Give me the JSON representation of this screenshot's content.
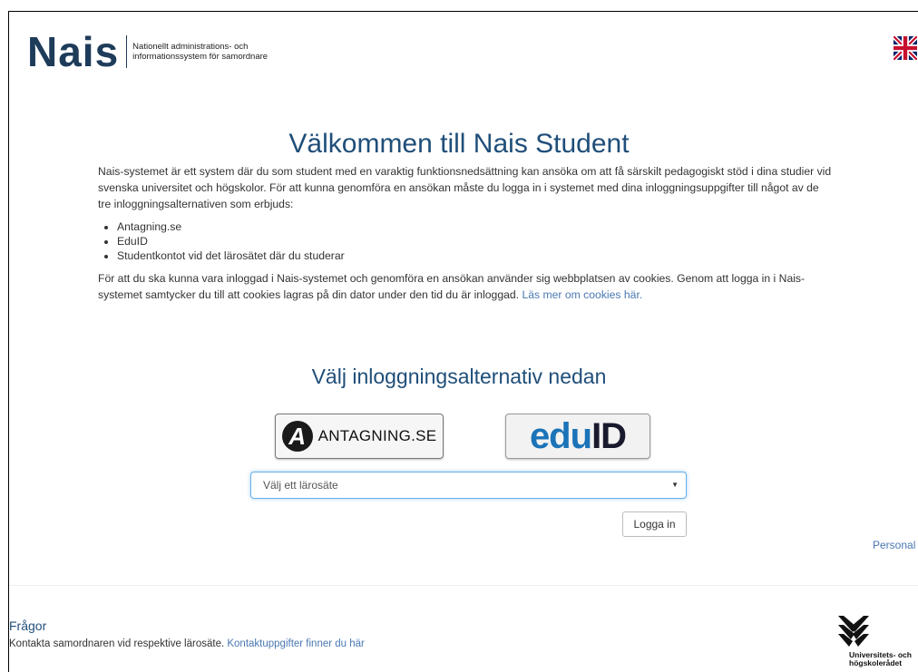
{
  "header": {
    "logo_text": "Nais",
    "logo_subtitle_line1": "Nationellt administrations- och",
    "logo_subtitle_line2": "informationssystem för samordnare",
    "language_flag_icon": "uk-flag-icon"
  },
  "welcome": {
    "title": "Välkommen till Nais Student",
    "intro": "Nais-systemet är ett system där du som student med en varaktig funktionsnedsättning kan ansöka om att få särskilt pedagogiskt stöd i dina studier vid svenska universitet och högskolor. För att kunna genomföra en ansökan måste du logga in i systemet med dina inloggningsuppgifter till något av de tre inloggningsalternativen som erbjuds:",
    "options": [
      "Antagning.se",
      "EduID",
      "Studentkontot vid det lärosätet där du studerar"
    ],
    "cookies_text": "För att du ska kunna vara inloggad i Nais-systemet och genomföra en ansökan använder sig webbplatsen av cookies. Genom att logga in i Nais-systemet samtycker du till att cookies lagras på din dator under den tid du är inloggad.",
    "cookies_link": "Läs mer om cookies här."
  },
  "login": {
    "title": "Välj inloggningsalternativ nedan",
    "antagning_letter": "A",
    "antagning_label": "ANTAGNING.SE",
    "eduid_part1": "edu",
    "eduid_part2": "ID",
    "select_placeholder": "Välj ett lärosäte",
    "login_button": "Logga in",
    "personal_link": "Personal"
  },
  "footer": {
    "faq_title": "Frågor",
    "faq_text": "Kontakta samordnaren vid respektive lärosäte.",
    "faq_link": "Kontaktuppgifter finner du här",
    "uhr_line1": "Universitets- och",
    "uhr_line2": "högskolerådet"
  }
}
